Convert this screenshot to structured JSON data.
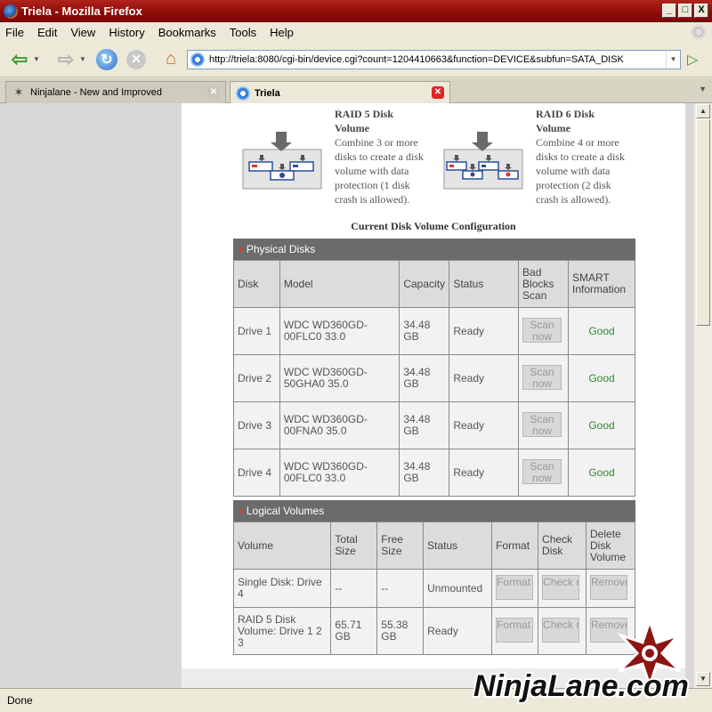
{
  "window": {
    "title": "Triela - Mozilla Firefox",
    "min": "_",
    "max": "□",
    "close": "X"
  },
  "menu": [
    "File",
    "Edit",
    "View",
    "History",
    "Bookmarks",
    "Tools",
    "Help"
  ],
  "nav": {
    "url": "http://triela:8080/cgi-bin/device.cgi?count=1204410663&function=DEVICE&subfun=SATA_DISK"
  },
  "tabs": [
    {
      "label": "Ninjalane - New and Improved",
      "active": false
    },
    {
      "label": "Triela",
      "active": true
    }
  ],
  "raid5": {
    "title_line1": "RAID 5 Disk",
    "title_line2": "Volume",
    "lines": [
      "Combine 3 or more",
      "disks to create a disk",
      "volume with data",
      "protection (1 disk",
      "crash is allowed)."
    ]
  },
  "raid6": {
    "title_line1": "RAID 6 Disk",
    "title_line2": "Volume",
    "lines": [
      "Combine 4 or more",
      "disks to create a disk",
      "volume with data",
      "protection (2 disk",
      "crash is allowed)."
    ]
  },
  "config_title": "Current Disk Volume Configuration",
  "physical": {
    "heading": "Physical Disks",
    "headers": [
      "Disk",
      "Model",
      "Capacity",
      "Status",
      "Bad Blocks Scan",
      "SMART Information"
    ],
    "rows": [
      {
        "disk": "Drive 1",
        "model": "WDC WD360GD-00FLC0 33.0",
        "capacity": "34.48 GB",
        "status": "Ready",
        "scan": "Scan now",
        "smart": "Good"
      },
      {
        "disk": "Drive 2",
        "model": "WDC WD360GD-50GHA0 35.0",
        "capacity": "34.48 GB",
        "status": "Ready",
        "scan": "Scan now",
        "smart": "Good"
      },
      {
        "disk": "Drive 3",
        "model": "WDC WD360GD-00FNA0 35.0",
        "capacity": "34.48 GB",
        "status": "Ready",
        "scan": "Scan now",
        "smart": "Good"
      },
      {
        "disk": "Drive 4",
        "model": "WDC WD360GD-00FLC0 33.0",
        "capacity": "34.48 GB",
        "status": "Ready",
        "scan": "Scan now",
        "smart": "Good"
      }
    ]
  },
  "logical": {
    "heading": "Logical Volumes",
    "headers": [
      "Volume",
      "Total Size",
      "Free Size",
      "Status",
      "Format",
      "Check Disk",
      "Delete Disk Volume"
    ],
    "rows": [
      {
        "volume": "Single Disk: Drive 4",
        "total": "--",
        "free": "--",
        "status": "Unmounted",
        "format": "Format now",
        "check": "Check now",
        "remove": "Remove now"
      },
      {
        "volume": "RAID 5 Disk Volume: Drive 1 2 3",
        "total": "65.71 GB",
        "free": "55.38 GB",
        "status": "Ready",
        "format": "Format now",
        "check": "Check now",
        "remove": "Remove now"
      }
    ]
  },
  "status": "Done",
  "watermark": "NinjaLane.com",
  "colors": {
    "title_bar": "#8e0c08",
    "section_head": "#6b6b6b",
    "good": "#2e8b2e",
    "bullet": "#e03b2a"
  }
}
